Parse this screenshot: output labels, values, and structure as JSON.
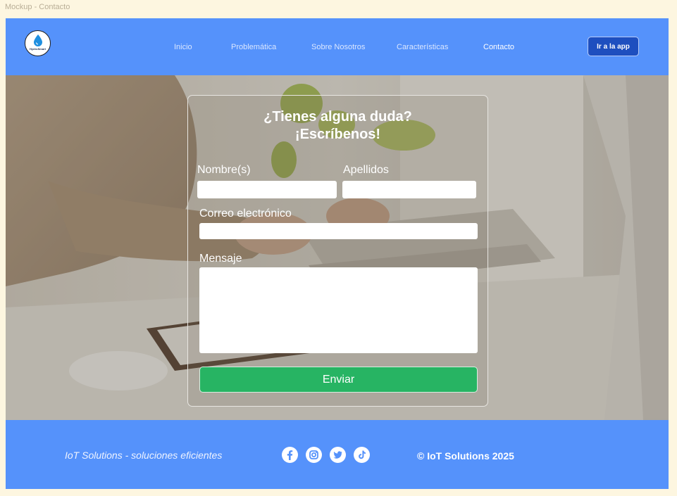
{
  "frame_label": "Mockup - Contacto",
  "header": {
    "logo_text": "HydroSmart",
    "nav": [
      {
        "label": "Inicio",
        "active": false
      },
      {
        "label": "Problemática",
        "active": false
      },
      {
        "label": "Sobre Nosotros",
        "active": false
      },
      {
        "label": "Características",
        "active": false
      },
      {
        "label": "Contacto",
        "active": true
      }
    ],
    "app_button": "Ir a la app"
  },
  "form": {
    "title_line1": "¿Tienes alguna duda?",
    "title_line2": "¡Escríbenos!",
    "first_name_label": "Nombre(s)",
    "last_name_label": "Apellidos",
    "email_label": "Correo electrónico",
    "message_label": "Mensaje",
    "first_name_value": "",
    "last_name_value": "",
    "email_value": "",
    "message_value": "",
    "submit_label": "Enviar"
  },
  "footer": {
    "tagline": "IoT Solutions - soluciones eficientes",
    "social_icons": [
      "facebook-icon",
      "instagram-icon",
      "twitter-icon",
      "tiktok-icon"
    ],
    "copyright": "© IoT Solutions 2025"
  },
  "colors": {
    "header_bg": "#5592fb",
    "app_button_bg": "#1e4fbf",
    "send_button_bg": "#27b463",
    "page_bg": "#fdf6e0"
  }
}
